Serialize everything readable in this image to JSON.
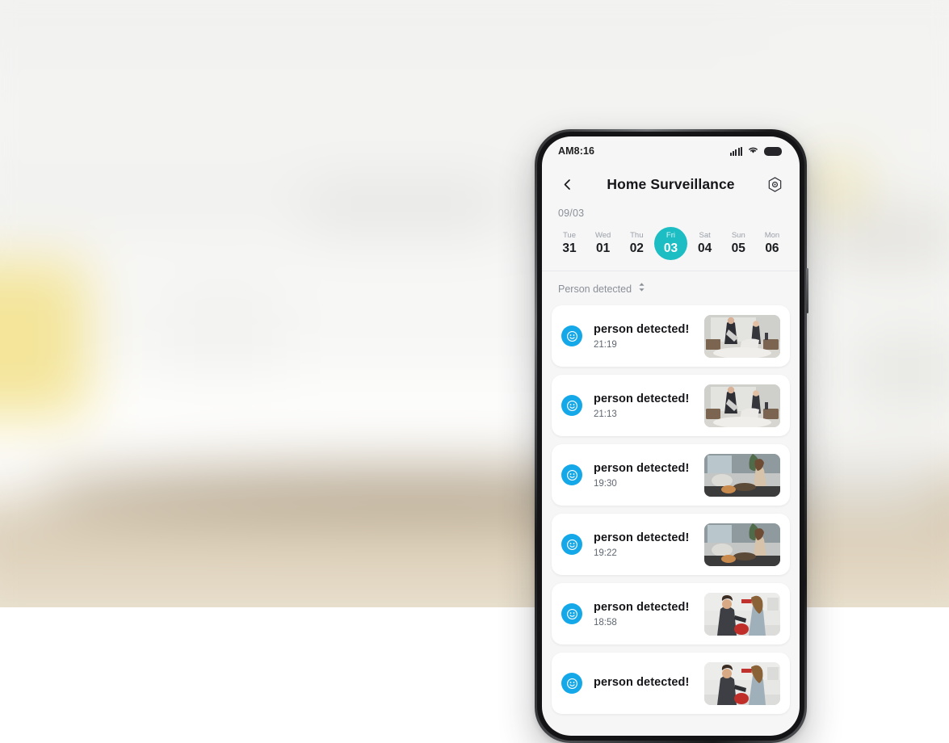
{
  "background": {
    "description": "blurred light living room with white sofa and yellow lamp"
  },
  "phone": {
    "statusbar": {
      "time": "AM8:16",
      "signal_icon": "signal-bars-icon",
      "wifi_icon": "wifi-icon",
      "battery_icon": "battery-full-icon"
    },
    "appbar": {
      "back_icon": "back-chevron-icon",
      "title": "Home  Surveillance",
      "settings_icon": "hexagon-settings-icon"
    },
    "month_label": "09/03",
    "dates": [
      {
        "dow": "Tue",
        "num": "31",
        "active": false
      },
      {
        "dow": "Wed",
        "num": "01",
        "active": false
      },
      {
        "dow": "Thu",
        "num": "02",
        "active": false
      },
      {
        "dow": "Fri",
        "num": "03",
        "active": true
      },
      {
        "dow": "Sat",
        "num": "04",
        "active": false
      },
      {
        "dow": "Sun",
        "num": "05",
        "active": false
      },
      {
        "dow": "Mon",
        "num": "06",
        "active": false
      }
    ],
    "filter": {
      "label": "Person detected",
      "sort_icon": "sort-updown-icon"
    },
    "events": [
      {
        "title": "person detected!",
        "time": "21:19",
        "icon": "person-detected-icon",
        "thumb": "bedroom-pillow-fight"
      },
      {
        "title": "person detected!",
        "time": "21:13",
        "icon": "person-detected-icon",
        "thumb": "bedroom-pillow-fight"
      },
      {
        "title": "person detected!",
        "time": "19:30",
        "icon": "person-detected-icon",
        "thumb": "living-room-woman-sofa"
      },
      {
        "title": "person detected!",
        "time": "19:22",
        "icon": "person-detected-icon",
        "thumb": "living-room-woman-sofa"
      },
      {
        "title": "person detected!",
        "time": "18:58",
        "icon": "person-detected-icon",
        "thumb": "kitchen-couple"
      },
      {
        "title": "person detected!",
        "time": "",
        "icon": "person-detected-icon",
        "thumb": "kitchen-couple"
      }
    ]
  },
  "colors": {
    "accent_teal": "#1dbdc4",
    "icon_blue": "#14a8e8",
    "text_primary": "#16161a",
    "text_muted": "#8a8f98",
    "screen_bg": "#f6f6f6"
  }
}
